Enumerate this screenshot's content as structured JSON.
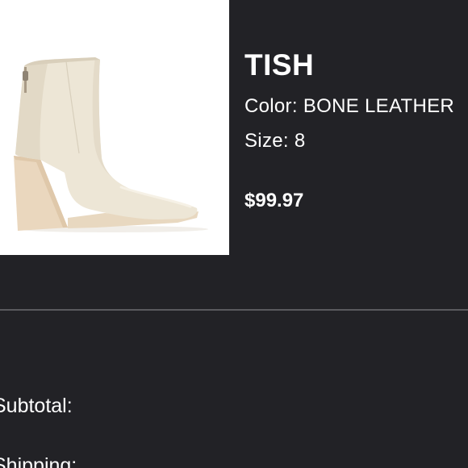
{
  "product": {
    "name": "TISH",
    "color_label": "Color:",
    "color_value": "BONE LEATHER",
    "size_label": "Size:",
    "size_value": "8",
    "price": "$99.97",
    "image_icon": "ankle-boot-image"
  },
  "summary": {
    "subtotal_label": "Subtotal:",
    "shipping_label": "Shipping:"
  },
  "colors": {
    "background": "#222226",
    "text": "#ffffff",
    "divider": "#5a5a5e",
    "image_background": "#ffffff",
    "boot_leather": "#ede6d6",
    "heel": "#ead7be"
  }
}
